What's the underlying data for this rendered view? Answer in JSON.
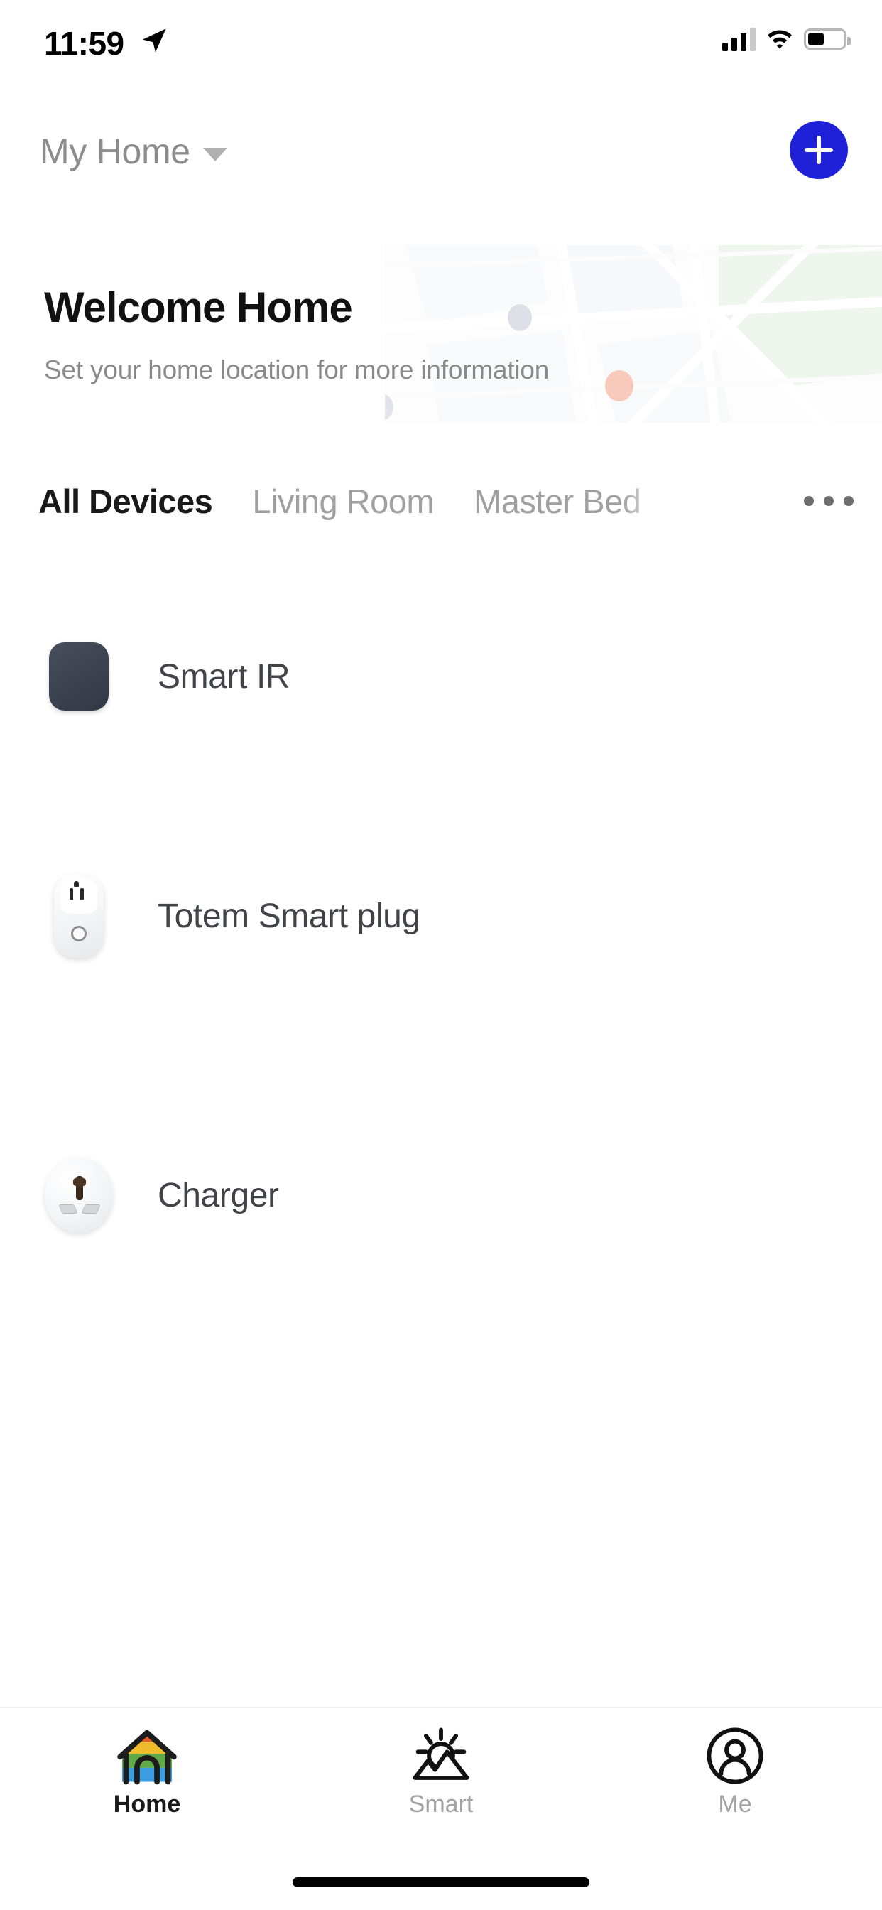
{
  "status_bar": {
    "time": "11:59",
    "location_icon": "location-arrow-icon",
    "signal_icon": "cellular-signal-icon",
    "wifi_icon": "wifi-icon",
    "battery_icon": "battery-icon",
    "battery_level_percent": 45
  },
  "header": {
    "home_name": "My Home",
    "dropdown_icon": "chevron-down-icon",
    "add_button_icon": "plus-icon",
    "add_button_color": "#1f21d8"
  },
  "banner": {
    "title": "Welcome Home",
    "subtitle": "Set your home location for more information",
    "map_marker_color": "#f2a085",
    "map_park_color": "#dfeede",
    "map_dot_color": "#c3c9d4"
  },
  "room_tabs": {
    "items": [
      {
        "label": "All Devices",
        "active": true
      },
      {
        "label": "Living Room",
        "active": false
      },
      {
        "label": "Master Bed",
        "active": false
      }
    ],
    "overflow_icon": "more-horizontal-icon"
  },
  "devices": [
    {
      "name": "Smart IR",
      "icon": "smart-ir-icon"
    },
    {
      "name": "Totem Smart plug",
      "icon": "smart-plug-icon"
    },
    {
      "name": "Charger",
      "icon": "charger-socket-icon"
    }
  ],
  "bottom_nav": {
    "items": [
      {
        "label": "Home",
        "icon": "house-icon",
        "active": true
      },
      {
        "label": "Smart",
        "icon": "scene-mountain-sun-icon",
        "active": false
      },
      {
        "label": "Me",
        "icon": "user-circle-icon",
        "active": false
      }
    ]
  }
}
